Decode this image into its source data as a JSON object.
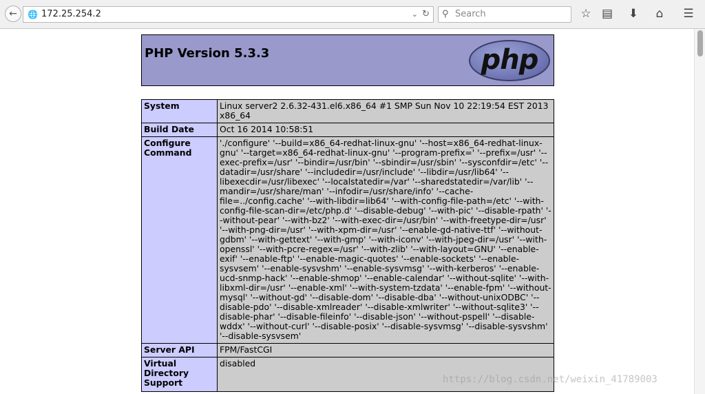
{
  "browser": {
    "url": "172.25.254.2",
    "search_placeholder": "Search"
  },
  "page": {
    "title": "PHP Version 5.3.3",
    "logo_text": "php"
  },
  "rows": [
    {
      "label": "System",
      "value": "Linux server2 2.6.32-431.el6.x86_64 #1 SMP Sun Nov 10 22:19:54 EST 2013 x86_64"
    },
    {
      "label": "Build Date",
      "value": "Oct 16 2014 10:58:51"
    },
    {
      "label": "Configure Command",
      "value": "'./configure' '--build=x86_64-redhat-linux-gnu' '--host=x86_64-redhat-linux-gnu' '--target=x86_64-redhat-linux-gnu' '--program-prefix=' '--prefix=/usr' '--exec-prefix=/usr' '--bindir=/usr/bin' '--sbindir=/usr/sbin' '--sysconfdir=/etc' '--datadir=/usr/share' '--includedir=/usr/include' '--libdir=/usr/lib64' '--libexecdir=/usr/libexec' '--localstatedir=/var' '--sharedstatedir=/var/lib' '--mandir=/usr/share/man' '--infodir=/usr/share/info' '--cache-file=../config.cache' '--with-libdir=lib64' '--with-config-file-path=/etc' '--with-config-file-scan-dir=/etc/php.d' '--disable-debug' '--with-pic' '--disable-rpath' '--without-pear' '--with-bz2' '--with-exec-dir=/usr/bin' '--with-freetype-dir=/usr' '--with-png-dir=/usr' '--with-xpm-dir=/usr' '--enable-gd-native-ttf' '--without-gdbm' '--with-gettext' '--with-gmp' '--with-iconv' '--with-jpeg-dir=/usr' '--with-openssl' '--with-pcre-regex=/usr' '--with-zlib' '--with-layout=GNU' '--enable-exif' '--enable-ftp' '--enable-magic-quotes' '--enable-sockets' '--enable-sysvsem' '--enable-sysvshm' '--enable-sysvmsg' '--with-kerberos' '--enable-ucd-snmp-hack' '--enable-shmop' '--enable-calendar' '--without-sqlite' '--with-libxml-dir=/usr' '--enable-xml' '--with-system-tzdata' '--enable-fpm' '--without-mysql' '--without-gd' '--disable-dom' '--disable-dba' '--without-unixODBC' '--disable-pdo' '--disable-xmlreader' '--disable-xmlwriter' '--without-sqlite3' '--disable-phar' '--disable-fileinfo' '--disable-json' '--without-pspell' '--disable-wddx' '--without-curl' '--disable-posix' '--disable-sysvmsg' '--disable-sysvshm' '--disable-sysvsem'"
    },
    {
      "label": "Server API",
      "value": "FPM/FastCGI"
    },
    {
      "label": "Virtual Directory Support",
      "value": "disabled"
    }
  ],
  "watermark": "https://blog.csdn.net/weixin_41789003"
}
